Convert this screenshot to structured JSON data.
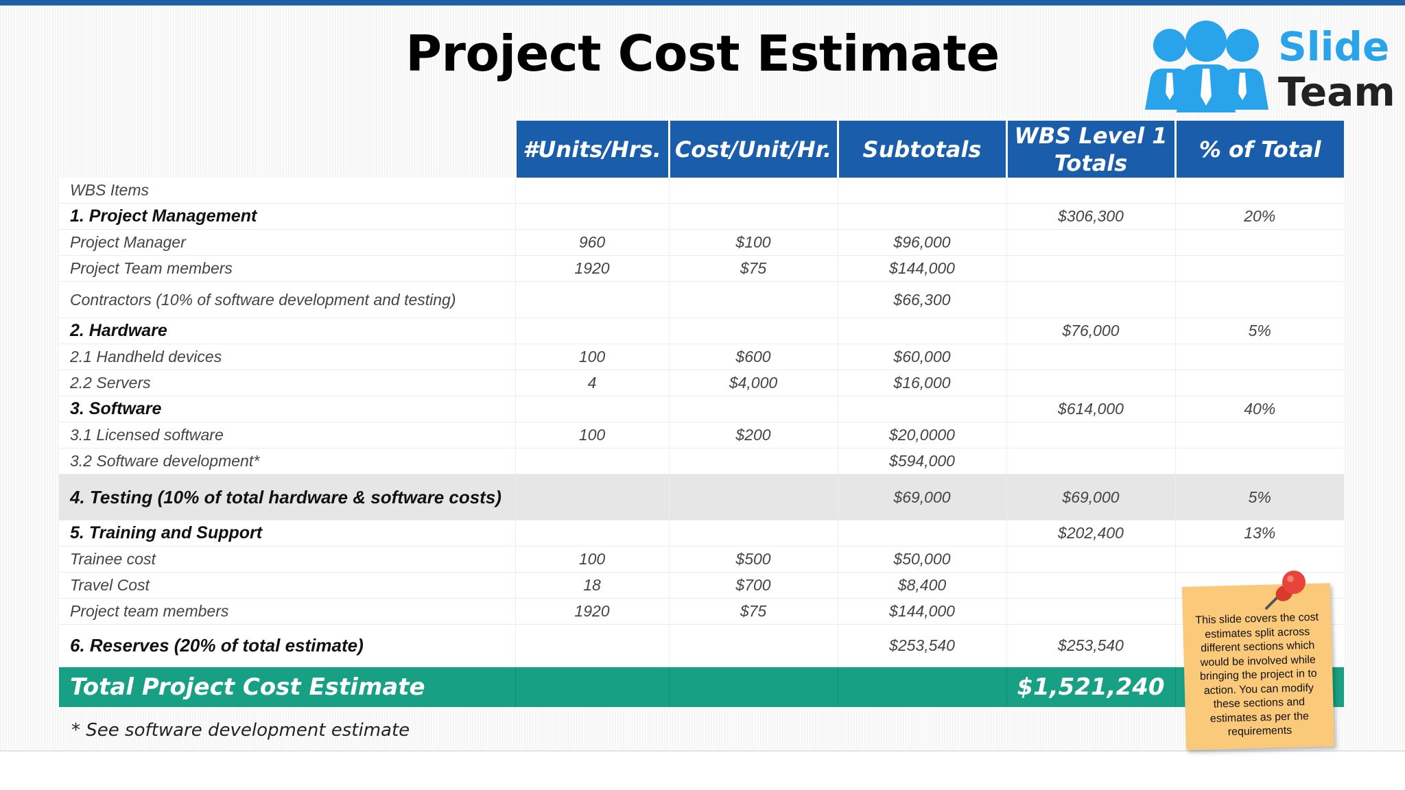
{
  "title": "Project Cost Estimate",
  "logo": {
    "line1": "Slide",
    "line2": "Team"
  },
  "columns": [
    "#Units/Hrs.",
    "Cost/Unit/Hr.",
    "Subtotals",
    "WBS Level 1 Totals",
    "% of Total"
  ],
  "rows": [
    {
      "label": "WBS Items",
      "units": "",
      "cost": "",
      "subtotal": "",
      "total": "",
      "pct": ""
    },
    {
      "label": "1. Project Management",
      "units": "",
      "cost": "",
      "subtotal": "",
      "total": "$306,300",
      "pct": "20%"
    },
    {
      "label": "Project Manager",
      "units": "960",
      "cost": "$100",
      "subtotal": "$96,000",
      "total": "",
      "pct": ""
    },
    {
      "label": "Project Team members",
      "units": "1920",
      "cost": "$75",
      "subtotal": "$144,000",
      "total": "",
      "pct": ""
    },
    {
      "label": "Contractors (10% of software development and testing)",
      "units": "",
      "cost": "",
      "subtotal": "$66,300",
      "total": "",
      "pct": ""
    },
    {
      "label": "2. Hardware",
      "units": "",
      "cost": "",
      "subtotal": "",
      "total": "$76,000",
      "pct": "5%"
    },
    {
      "label": "2.1 Handheld devices",
      "units": "100",
      "cost": "$600",
      "subtotal": "$60,000",
      "total": "",
      "pct": ""
    },
    {
      "label": "2.2 Servers",
      "units": "4",
      "cost": "$4,000",
      "subtotal": "$16,000",
      "total": "",
      "pct": ""
    },
    {
      "label": "3. Software",
      "units": "",
      "cost": "",
      "subtotal": "",
      "total": "$614,000",
      "pct": "40%"
    },
    {
      "label": "3.1 Licensed software",
      "units": "100",
      "cost": "$200",
      "subtotal": "$20,0000",
      "total": "",
      "pct": ""
    },
    {
      "label": "3.2 Software development*",
      "units": "",
      "cost": "",
      "subtotal": "$594,000",
      "total": "",
      "pct": ""
    },
    {
      "label": "4. Testing (10% of total hardware & software costs)",
      "units": "",
      "cost": "",
      "subtotal": "$69,000",
      "total": "$69,000",
      "pct": "5%"
    },
    {
      "label": "5. Training and Support",
      "units": "",
      "cost": "",
      "subtotal": "",
      "total": "$202,400",
      "pct": "13%"
    },
    {
      "label": "Trainee cost",
      "units": "100",
      "cost": "$500",
      "subtotal": "$50,000",
      "total": "",
      "pct": ""
    },
    {
      "label": "Travel Cost",
      "units": "18",
      "cost": "$700",
      "subtotal": "$8,400",
      "total": "",
      "pct": ""
    },
    {
      "label": "Project team members",
      "units": "1920",
      "cost": "$75",
      "subtotal": "$144,000",
      "total": "",
      "pct": ""
    },
    {
      "label": "6. Reserves (20% of total estimate)",
      "units": "",
      "cost": "",
      "subtotal": "$253,540",
      "total": "$253,540",
      "pct": ""
    }
  ],
  "total_row": {
    "label": "Total Project Cost Estimate",
    "value": "$1,521,240"
  },
  "footnote": "* See software development estimate",
  "sticky_note": "This slide covers the cost estimates split across different sections which would be involved while bringing the project in to action. You can modify these sections and estimates as per the requirements",
  "colors": {
    "header_blue": "#1a5eab",
    "total_green": "#17a084",
    "note_orange": "#fbc97a",
    "logo_blue": "#29a3ea"
  }
}
